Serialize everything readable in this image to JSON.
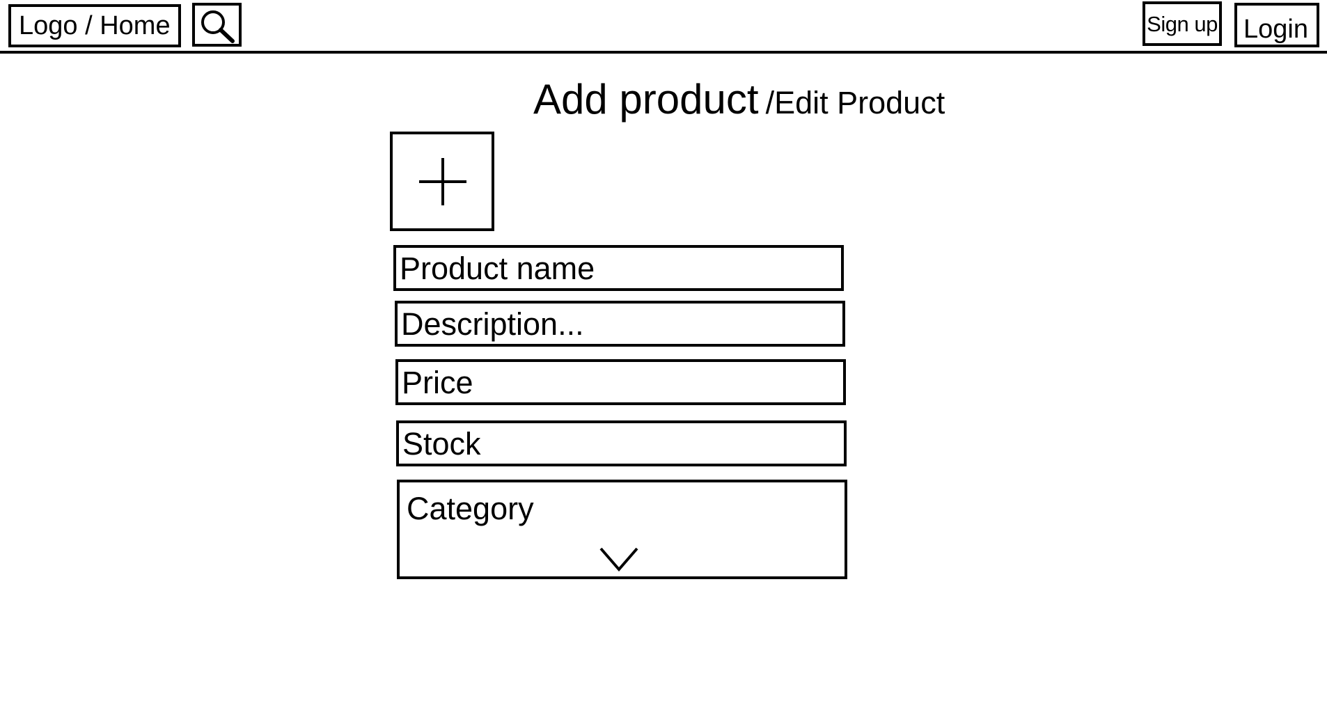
{
  "header": {
    "logo_home_label": "Logo / Home",
    "search_icon": "search-icon",
    "signup_label": "Sign up",
    "login_label": "Login"
  },
  "page": {
    "title": "Add product",
    "subtitle": "/Edit Product"
  },
  "form": {
    "add_image_icon": "plus-icon",
    "product_name_placeholder": "Product name",
    "description_placeholder": "Description...",
    "price_placeholder": "Price",
    "stock_placeholder": "Stock",
    "category_label": "Category",
    "category_icon": "chevron-down-icon"
  }
}
